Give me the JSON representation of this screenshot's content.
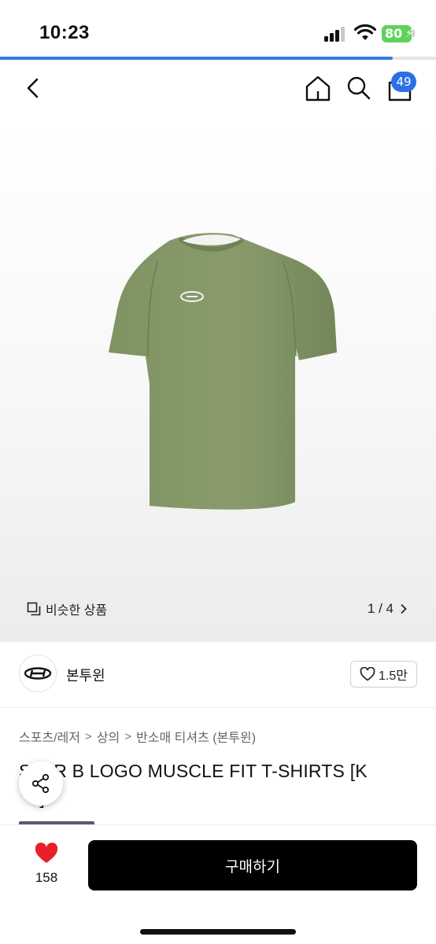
{
  "status_bar": {
    "time": "10:23",
    "battery_percent": "80",
    "icons": [
      "cellular-signal-icon",
      "wifi-icon",
      "battery-charging-icon"
    ],
    "battery_color": "#5ed35c"
  },
  "page_load_progress": 0.9,
  "nav": {
    "icons": [
      "back-chevron-icon",
      "home-icon",
      "search-icon",
      "shopping-bag-icon"
    ],
    "cart_badge": "49",
    "badge_color": "#2b6fe6"
  },
  "hero": {
    "image_subject": "olive green t-shirt with small white logo",
    "similar_label": "비슷한 상품",
    "counter": "1 / 4"
  },
  "brand": {
    "name": "본투윈",
    "likes": "1.5만"
  },
  "breadcrumb": [
    "스포츠/레저",
    "상의",
    "반소매 티셔츠 (본투윈)"
  ],
  "product": {
    "title_line1": "S  ER B LOGO MUSCLE FIT T-SHIRTS [K",
    "title_line2": "   I]"
  },
  "bottom_bar": {
    "wish_count": "158",
    "buy_label": "구매하기",
    "heart_color": "#e8202a",
    "button_color": "#000000"
  }
}
